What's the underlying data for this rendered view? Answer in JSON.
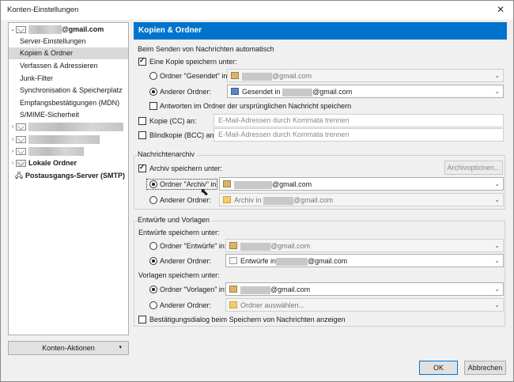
{
  "window": {
    "title": "Konten-Einstellungen",
    "close": "✕"
  },
  "tree": {
    "account_email": "@gmail.com",
    "items": [
      "Server-Einstellungen",
      "Kopien & Ordner",
      "Verfassen & Adressieren",
      "Junk-Filter",
      "Synchronisation & Speicherplatz",
      "Empfangsbestätigungen (MDN)",
      "S/MIME-Sicherheit"
    ],
    "local_folders": "Lokale Ordner",
    "smtp": "Postausgangs-Server (SMTP)"
  },
  "account_actions": "Konten-Aktionen",
  "header": "Kopien & Ordner",
  "send": {
    "section": "Beim Senden von Nachrichten automatisch",
    "save_copy": "Eine Kopie speichern unter:",
    "radio_sent": "Ordner \"Gesendet\" in:",
    "sent_value": "@gmail.com",
    "radio_other": "Anderer Ordner:",
    "other_value_prefix": "Gesendet in",
    "other_value_suffix": "@gmail.com",
    "reply_in_folder": "Antworten im Ordner der ursprünglichen Nachricht speichern",
    "cc": "Kopie (CC) an:",
    "cc_placeholder": "E-Mail-Adressen durch Kommata trennen",
    "bcc": "Blindkopie (BCC) an:",
    "bcc_placeholder": "E-Mail-Adressen durch Kommata trennen"
  },
  "archive": {
    "section": "Nachrichtenarchiv",
    "keep": "Archiv speichern unter:",
    "options_button": "Archivoptionen...",
    "radio_archive": "Ordner \"Archiv\" in:",
    "archive_value": "@gmail.com",
    "radio_other": "Anderer Ordner:",
    "other_value_prefix": "Archiv in",
    "other_value_suffix": "@gmail.com"
  },
  "drafts": {
    "section": "Entwürfe und Vorlagen",
    "drafts_label": "Entwürfe speichern unter:",
    "radio_drafts": "Ordner \"Entwürfe\" in:",
    "drafts_value": "@gmail.com",
    "radio_other": "Anderer Ordner:",
    "other_value_prefix": "Entwürfe in",
    "other_value_suffix": "@gmail.com",
    "templates_label": "Vorlagen speichern unter:",
    "radio_templates": "Ordner \"Vorlagen\" in:",
    "templates_value": "@gmail.com",
    "radio_other2": "Anderer Ordner:",
    "other2_value": "Ordner auswählen...",
    "confirm": "Bestätigungsdialog beim Speichern von Nachrichten anzeigen"
  },
  "footer": {
    "ok": "OK",
    "cancel": "Abbrechen"
  },
  "icons": {
    "caret": "⌄",
    "dropdown": "▾",
    "expand": "›",
    "collapse": "⌄"
  }
}
